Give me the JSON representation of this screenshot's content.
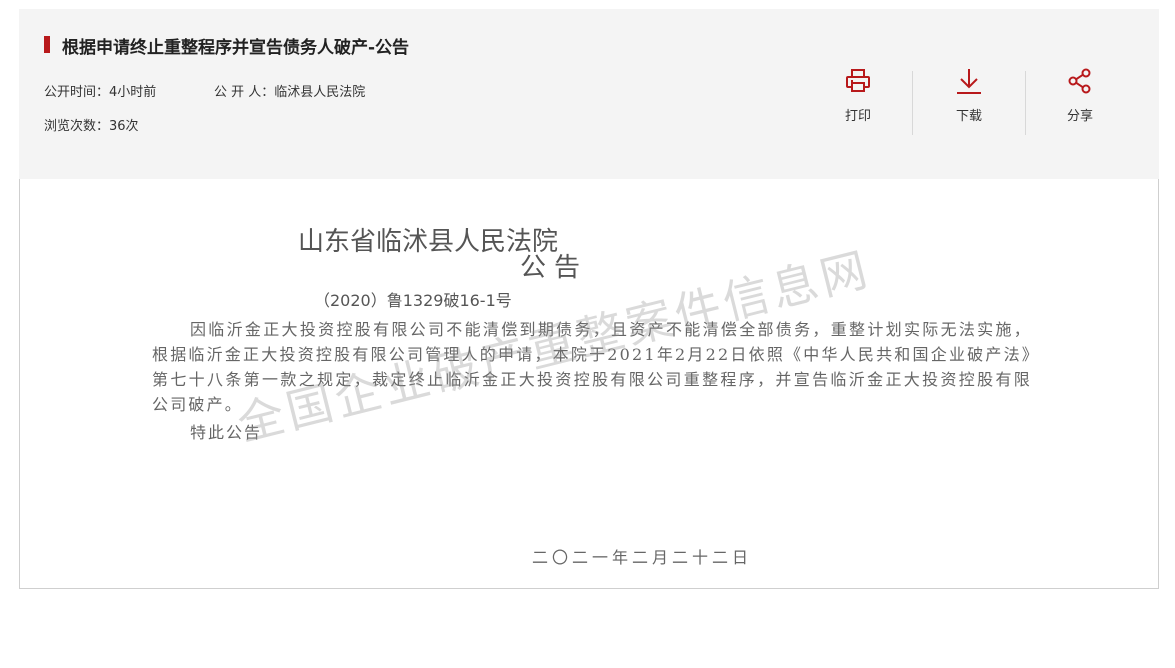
{
  "header": {
    "title": "根据申请终止重整程序并宣告债务人破产-公告",
    "publish_time_label": "公开时间：",
    "publish_time": "4小时前",
    "publisher_label": "公 开 人：",
    "publisher": "临沭县人民法院",
    "views_label": "浏览次数：",
    "views": "36次"
  },
  "actions": {
    "print": "打印",
    "download": "下载",
    "share": "分享"
  },
  "document": {
    "court": "山东省临沭县人民法院",
    "notice": "公告",
    "case_number": "（2020）鲁1329破16-1号",
    "body": "因临沂金正大投资控股有限公司不能清偿到期债务，且资产不能清偿全部债务，重整计划实际无法实施，根据临沂金正大投资控股有限公司管理人的申请，本院于2021年2月22日依照《中华人民共和国企业破产法》第七十八条第一款之规定，裁定终止临沂金正大投资控股有限公司重整程序，并宣告临沂金正大投资控股有限公司破产。",
    "closing": "特此公告",
    "date": "二〇二一年二月二十二日"
  },
  "watermark": "全国企业破产重整案件信息网",
  "colors": {
    "accent": "#b8191b",
    "header_bg": "#f4f4f4"
  },
  "icons": {
    "print": "printer-icon",
    "download": "download-icon",
    "share": "share-icon"
  }
}
